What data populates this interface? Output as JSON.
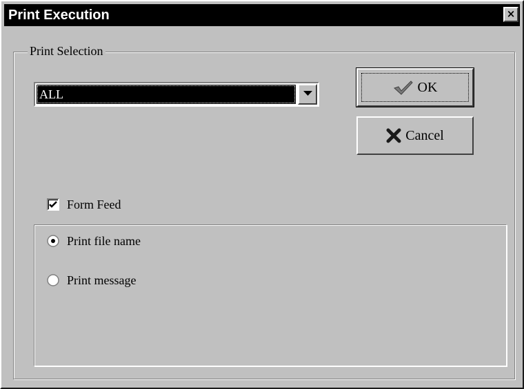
{
  "window": {
    "title": "Print Execution",
    "close_glyph": "×"
  },
  "print_selection": {
    "group_label": "Print Selection",
    "selected_value": "ALL"
  },
  "buttons": {
    "ok_label": "OK",
    "cancel_label": "Cancel",
    "ok_icon": "checkmark-icon",
    "cancel_icon": "x-icon"
  },
  "options": {
    "form_feed_label": "Form Feed",
    "form_feed_checked": true,
    "radio_print_file_name_label": "Print file name",
    "radio_print_message_label": "Print message",
    "selected_radio": "Print file name"
  },
  "colors": {
    "dialog_bg": "#c0c0c0",
    "titlebar_bg": "#000000",
    "selection_bg": "#000000"
  }
}
